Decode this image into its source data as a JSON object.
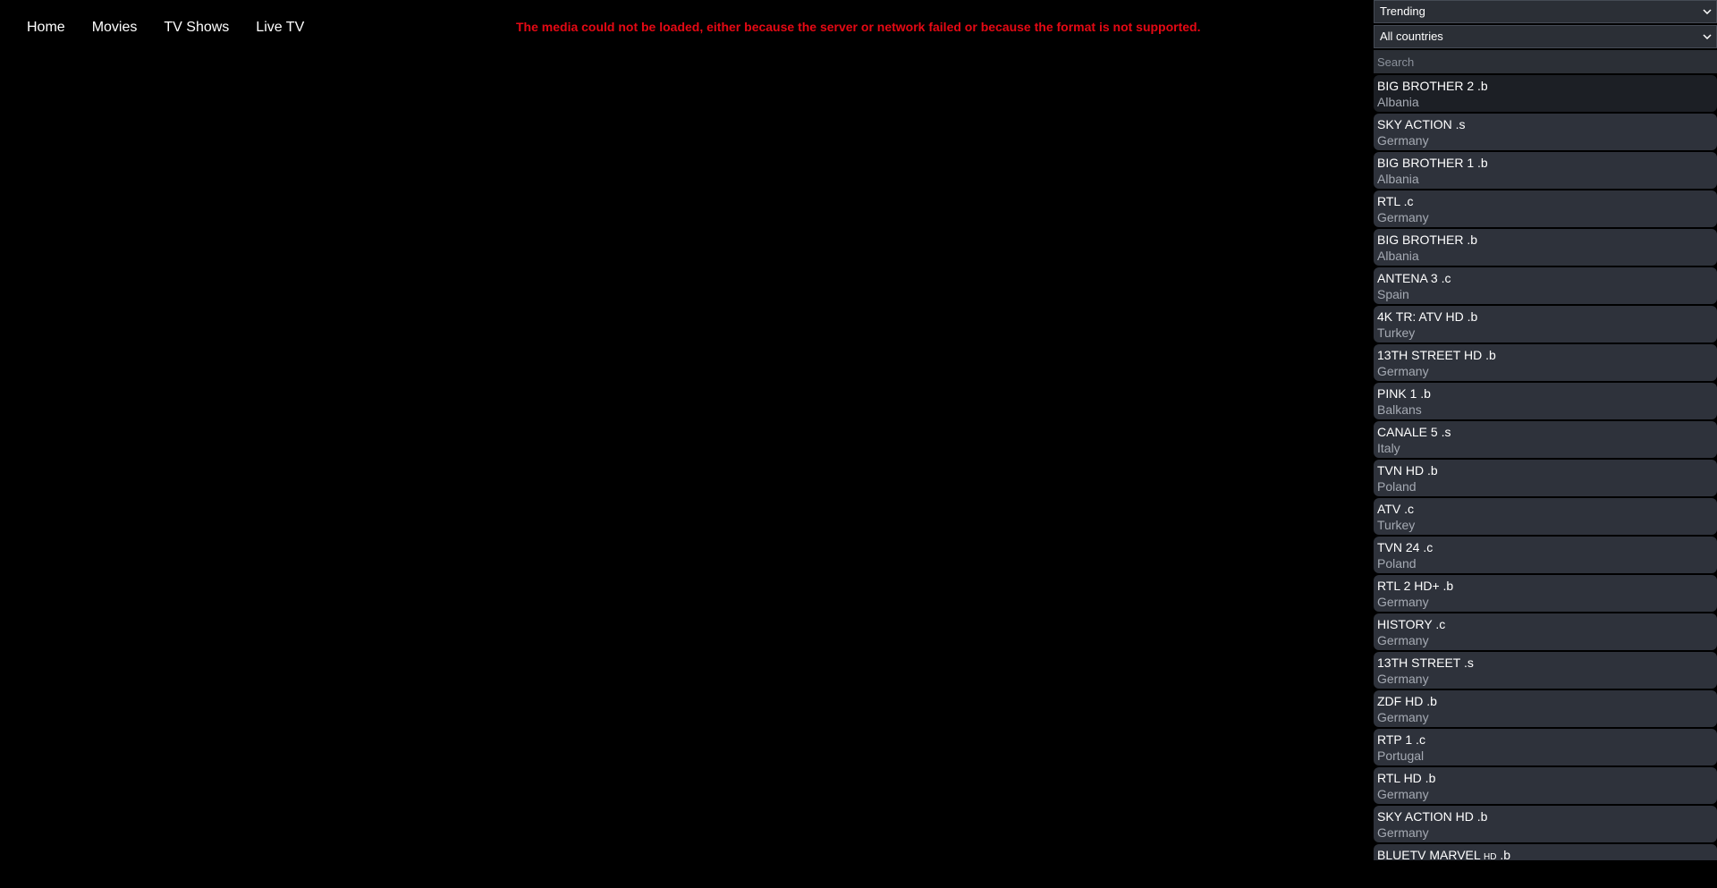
{
  "nav": {
    "items": [
      {
        "label": "Home"
      },
      {
        "label": "Movies"
      },
      {
        "label": "TV Shows"
      },
      {
        "label": "Live TV"
      }
    ]
  },
  "player": {
    "error": "The media could not be loaded, either because the server or network failed or because the format is not supported."
  },
  "sidebar": {
    "sort_select": "Trending",
    "country_select": "All countries",
    "search_placeholder": "Search",
    "channels": [
      {
        "name": "BIG BROTHER 2 .b",
        "country": "Albania"
      },
      {
        "name": "SKY ACTION .s",
        "country": "Germany"
      },
      {
        "name": "BIG BROTHER 1 .b",
        "country": "Albania"
      },
      {
        "name": "RTL .c",
        "country": "Germany"
      },
      {
        "name": "BIG BROTHER .b",
        "country": "Albania"
      },
      {
        "name": "ANTENA 3 .c",
        "country": "Spain"
      },
      {
        "name": "4K TR: ATV HD .b",
        "country": "Turkey"
      },
      {
        "name": "13TH STREET HD .b",
        "country": "Germany"
      },
      {
        "name": "PINK 1 .b",
        "country": "Balkans"
      },
      {
        "name": "CANALE 5 .s",
        "country": "Italy"
      },
      {
        "name": "TVN HD .b",
        "country": "Poland"
      },
      {
        "name": "ATV .c",
        "country": "Turkey"
      },
      {
        "name": "TVN 24 .c",
        "country": "Poland"
      },
      {
        "name": "RTL 2 HD+ .b",
        "country": "Germany"
      },
      {
        "name": "HISTORY .c",
        "country": "Germany"
      },
      {
        "name": "13TH STREET .s",
        "country": "Germany"
      },
      {
        "name": "ZDF HD .b",
        "country": "Germany"
      },
      {
        "name": "RTP 1 .c",
        "country": "Portugal"
      },
      {
        "name": "RTL HD .b",
        "country": "Germany"
      },
      {
        "name": "SKY ACTION HD .b",
        "country": "Germany"
      }
    ],
    "last_channel": {
      "name_prefix": "BLUETV MARVEL ",
      "name_hd": "HD",
      "name_suffix": " .b"
    }
  }
}
